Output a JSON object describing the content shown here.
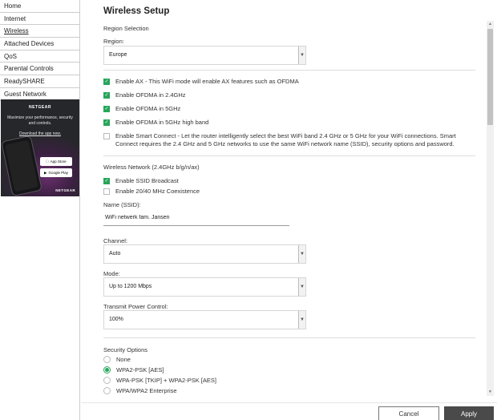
{
  "sidebar": {
    "items": [
      {
        "label": "Home"
      },
      {
        "label": "Internet"
      },
      {
        "label": "Wireless"
      },
      {
        "label": "Attached Devices"
      },
      {
        "label": "QoS"
      },
      {
        "label": "Parental Controls"
      },
      {
        "label": "ReadySHARE"
      },
      {
        "label": "Guest Network"
      }
    ],
    "active": "Wireless",
    "promo": {
      "logo": "NETGEAR",
      "text": "Maximize your performance, security and controls.",
      "link": "Download the app now.",
      "app_store": "App Store",
      "google_play": "Google Play",
      "brand": "NETGEAR"
    }
  },
  "main": {
    "title": "Wireless Setup",
    "region_selection": "Region Selection",
    "region_label": "Region:",
    "region_value": "Europe",
    "options": [
      {
        "label": "Enable AX - This WiFi mode will enable AX features such as OFDMA",
        "checked": true
      },
      {
        "label": "Enable OFDMA in 2.4GHz",
        "checked": true
      },
      {
        "label": "Enable OFDMA in 5GHz",
        "checked": true
      },
      {
        "label": "Enable OFDMA in 5GHz high band",
        "checked": true
      },
      {
        "label": "Enable Smart Connect - Let the router intelligently select the best WiFi band 2.4 GHz or 5 GHz for your WiFi connections. Smart Connect requires the 2.4 GHz and 5 GHz networks to use the same WiFi network name (SSID), security options and password.",
        "checked": false
      }
    ],
    "wireless_network_label": "Wireless Network (2.4GHz b/g/n/ax)",
    "ssid_broadcast": {
      "label": "Enable SSID Broadcast",
      "checked": true
    },
    "coexistence": {
      "label": "Enable 20/40 MHz Coexistence",
      "checked": false
    },
    "ssid_label": "Name (SSID):",
    "ssid_value": "WiFi netwerk fam. Jansen",
    "channel_label": "Channel:",
    "channel_value": "Auto",
    "mode_label": "Mode:",
    "mode_value": "Up to 1200 Mbps",
    "power_label": "Transmit Power Control:",
    "power_value": "100%",
    "security_label": "Security Options",
    "security_options": [
      {
        "label": "None",
        "selected": false
      },
      {
        "label": "WPA2-PSK [AES]",
        "selected": true
      },
      {
        "label": "WPA-PSK [TKIP] + WPA2-PSK [AES]",
        "selected": false
      },
      {
        "label": "WPA/WPA2 Enterprise",
        "selected": false
      }
    ]
  },
  "footer": {
    "cancel": "Cancel",
    "apply": "Apply"
  },
  "colors": {
    "accent_green": "#27a55a",
    "apply_bg": "#4a4a4a",
    "promo_bg": "#26272b"
  }
}
